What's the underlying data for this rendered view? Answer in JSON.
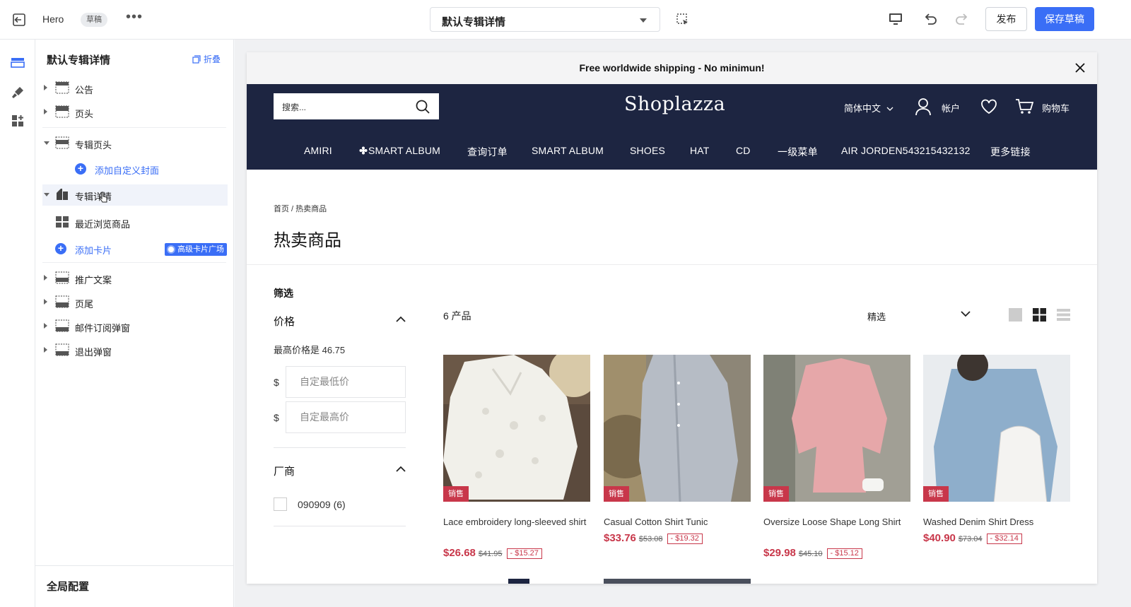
{
  "topbar": {
    "theme_name": "Hero",
    "badge": "草稿",
    "more": "•••",
    "page_select": "默认专辑详情",
    "publish": "发布",
    "save_draft": "保存草稿"
  },
  "panel": {
    "title": "默认专辑详情",
    "collapse": "折叠",
    "items": [
      {
        "label": "公告"
      },
      {
        "label": "页头"
      },
      {
        "label": "专辑页头"
      },
      {
        "label": "添加自定义封面"
      },
      {
        "label": "专辑详情"
      },
      {
        "label": "最近浏览商品"
      },
      {
        "label": "添加卡片"
      },
      {
        "label": "推广文案"
      },
      {
        "label": "页尾"
      },
      {
        "label": "邮件订阅弹窗"
      },
      {
        "label": "退出弹窗"
      }
    ],
    "advanced_tag": "高级卡片广场",
    "footer": "全局配置"
  },
  "store": {
    "announcement": "Free worldwide shipping - No minimun!",
    "search_placeholder": "搜索...",
    "logo": "Shoplazza",
    "language": "简体中文",
    "account": "帐户",
    "cart": "购物车",
    "nav": [
      "AMIRI",
      "SMART ALBUM",
      "查询订单",
      "SMART ALBUM",
      "SHOES",
      "HAT",
      "CD",
      "一级菜单",
      "AIR JORDEN543215432132",
      "更多链接"
    ],
    "breadcrumb": "首页 / 热卖商品",
    "heading": "热卖商品",
    "filter": {
      "title": "筛选",
      "price_label": "价格",
      "max_price": "最高价格是 46.75",
      "currency": "$",
      "min_placeholder": "自定最低价",
      "max_placeholder": "自定最高价",
      "vendor_label": "厂商",
      "vendor_option": "090909 (6)"
    },
    "product_count": "6 产品",
    "sort": "精选",
    "sale_badge": "销售",
    "products": [
      {
        "title": "Lace embroidery long-sleeved shirt",
        "price": "$26.68",
        "old": "$41.95",
        "discount": "- $15.27"
      },
      {
        "title": "Casual Cotton Shirt Tunic",
        "price": "$33.76",
        "old": "$53.08",
        "discount": "- $19.32"
      },
      {
        "title": "Oversize Loose Shape Long Shirt",
        "price": "$29.98",
        "old": "$45.10",
        "discount": "- $15.12"
      },
      {
        "title": "Washed Denim Shirt Dress",
        "price": "$40.90",
        "old": "$73.04",
        "discount": "- $32.14"
      }
    ]
  },
  "colors": {
    "accent": "#3a6ef6",
    "store_header": "#1d2541",
    "sale": "#c8374a"
  }
}
